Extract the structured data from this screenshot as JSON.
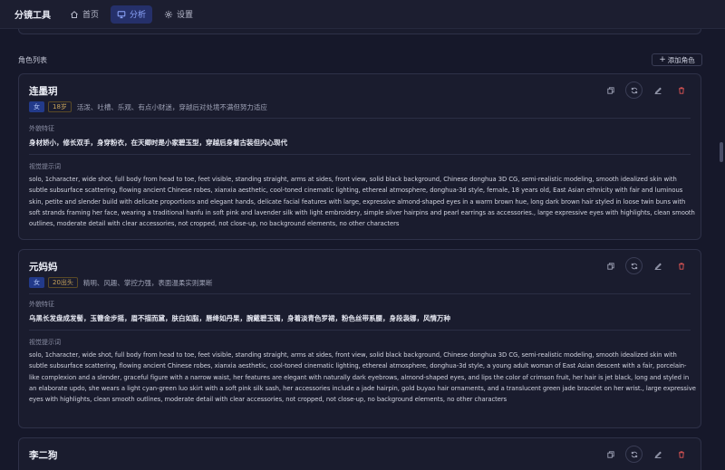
{
  "app": {
    "title": "分镜工具"
  },
  "nav": [
    {
      "label": "首页",
      "icon": "home-icon",
      "active": false
    },
    {
      "label": "分析",
      "icon": "monitor-icon",
      "active": true
    },
    {
      "label": "设置",
      "icon": "gear-icon",
      "active": false
    }
  ],
  "section": {
    "title": "角色列表",
    "add_label": "添加角色"
  },
  "labels": {
    "appearance": "外貌特征",
    "prompt": "视觉提示词"
  },
  "colors": {
    "accent": "#8fa8ff",
    "gender_tag_bg": "#223a8a",
    "age_tag": "#c8a45a",
    "delete": "#e05555"
  },
  "characters": [
    {
      "name": "连墨玥",
      "gender": "女",
      "age": "18岁",
      "personality": "活泼、吐槽、乐观、有点小财迷，穿越后对处境不满但努力适应",
      "appearance": "身材娇小，修长双手，身穿粉衣，在天卿时是小家碧玉型，穿越后身着古装但内心现代",
      "prompt": "solo, 1character, wide shot, full body from head to toe, feet visible, standing straight, arms at sides, front view, solid black background, Chinese donghua 3D CG, semi-realistic modeling, smooth idealized skin with subtle subsurface scattering, flowing ancient Chinese robes, xianxia aesthetic, cool-toned cinematic lighting, ethereal atmosphere, donghua-3d style, female, 18 years old, East Asian ethnicity with fair and luminous skin, petite and slender build with delicate proportions and elegant hands, delicate facial features with large, expressive almond-shaped eyes in a warm brown hue, long dark brown hair styled in loose twin buns with soft strands framing her face, wearing a traditional hanfu in soft pink and lavender silk with light embroidery, simple silver hairpins and pearl earrings as accessories., large expressive eyes with highlights, clean smooth outlines, moderate detail with clear accessories, not cropped, not close-up, no background elements, no other characters"
    },
    {
      "name": "元妈妈",
      "gender": "女",
      "age": "20出头",
      "personality": "精明、风趣、掌控力强，表面温柔实则果断",
      "appearance": "乌黑长发盘成发髻，玉簪金步摇，眉不描而黛，肤白如脂，唇绛如丹果，腕戴碧玉镯，身着淡青色罗裙，粉色丝带系腰，身段袅娜，风情万种",
      "prompt": "solo, 1character, wide shot, full body from head to toe, feet visible, standing straight, arms at sides, front view, solid black background, Chinese donghua 3D CG, semi-realistic modeling, smooth idealized skin with subtle subsurface scattering, flowing ancient Chinese robes, xianxia aesthetic, cool-toned cinematic lighting, ethereal atmosphere, donghua-3d style, a young adult woman of East Asian descent with a fair, porcelain-like complexion and a slender, graceful figure with a narrow waist, her features are elegant with naturally dark eyebrows, almond-shaped eyes, and lips the color of crimson fruit, her hair is jet black, long and styled in an elaborate updo, she wears a light cyan-green luo skirt with a soft pink silk sash, her accessories include a jade hairpin, gold buyao hair ornaments, and a translucent green jade bracelet on her wrist., large expressive eyes with highlights, clean smooth outlines, moderate detail with clear accessories, not cropped, not close-up, no background elements, no other characters"
    },
    {
      "name": "李二狗"
    }
  ]
}
